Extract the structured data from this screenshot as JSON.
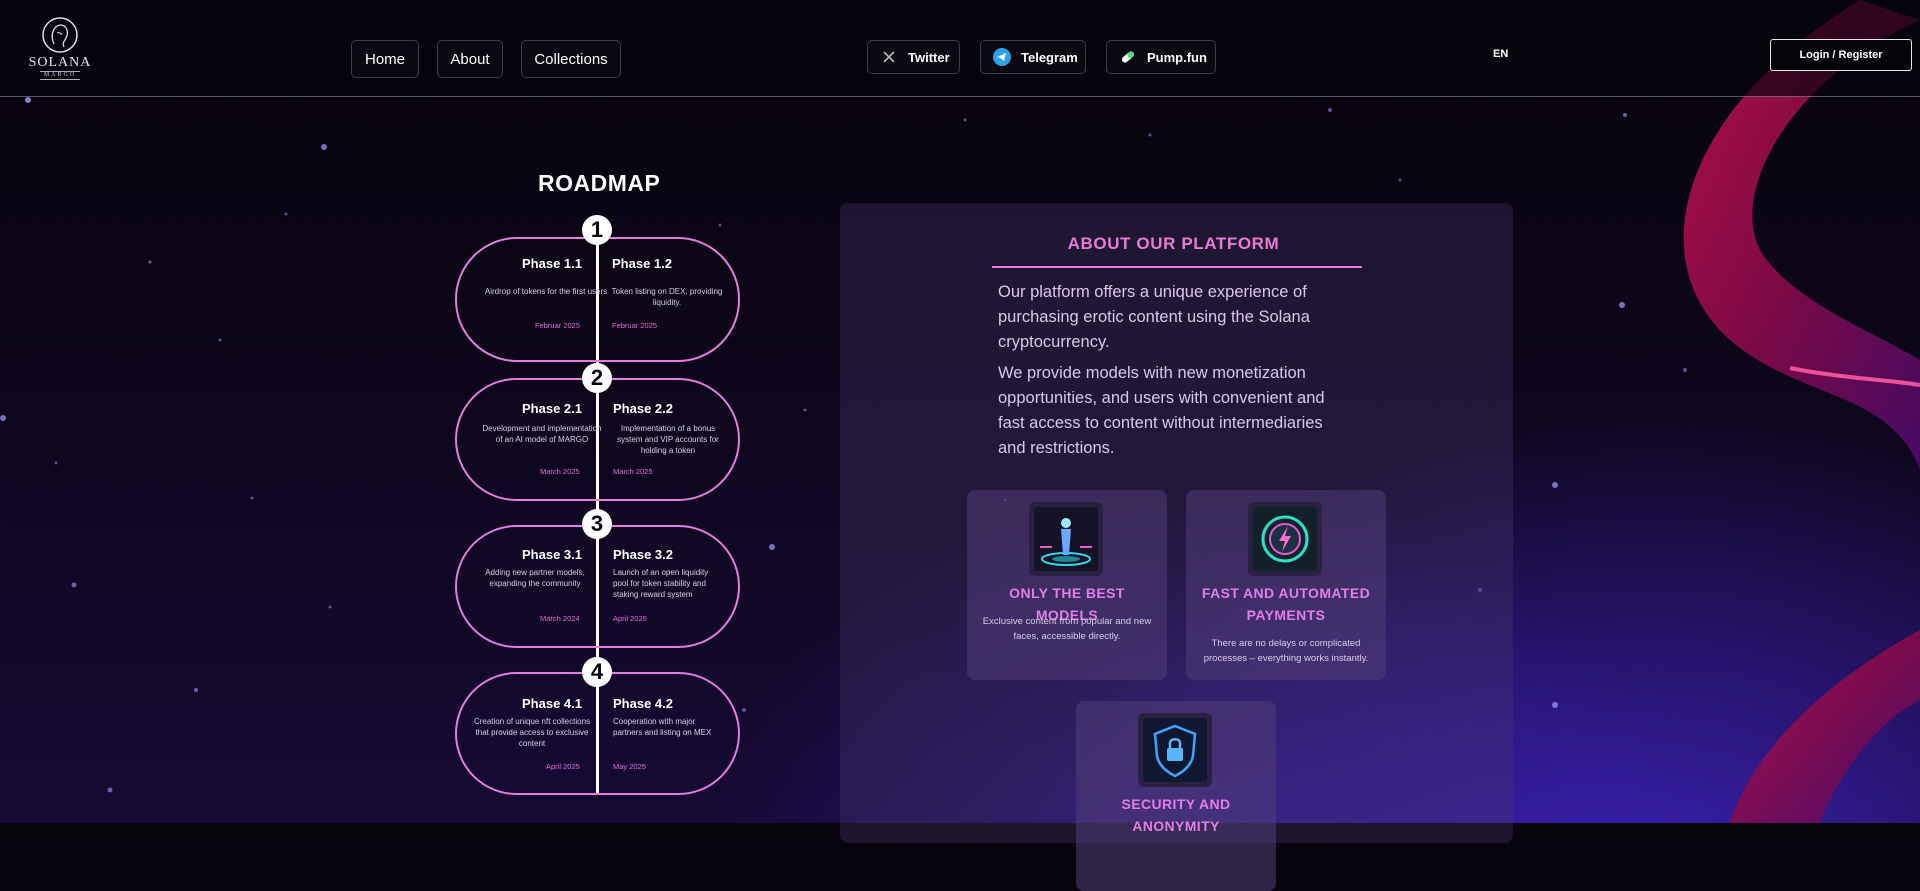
{
  "brand": {
    "name": "SOLANA",
    "sub": "MARGO"
  },
  "nav": [
    {
      "label": "Home"
    },
    {
      "label": "About"
    },
    {
      "label": "Collections"
    }
  ],
  "social": [
    {
      "label": "Twitter",
      "icon": "x-icon"
    },
    {
      "label": "Telegram",
      "icon": "telegram-icon"
    },
    {
      "label": "Pump.fun",
      "icon": "pill-icon"
    }
  ],
  "lang": "EN",
  "login_label": "Login / Register",
  "roadmap": {
    "title": "ROADMAP",
    "stages": [
      {
        "number": "1",
        "left": {
          "title": "Phase 1.1",
          "desc": "Airdrop of tokens for the first users",
          "date": "Februar 2025"
        },
        "right": {
          "title": "Phase 1.2",
          "desc": "Token listing on DEX, providing liquidity.",
          "date": "Februar 2025"
        }
      },
      {
        "number": "2",
        "left": {
          "title": "Phase 2.1",
          "desc": "Development and implementation of an AI model of MARGO",
          "date": "March 2025"
        },
        "right": {
          "title": "Phase 2.2",
          "desc": "Implementation of a bonus system and VIP accounts for holding a token",
          "date": "March 2025"
        }
      },
      {
        "number": "3",
        "left": {
          "title": "Phase 3.1",
          "desc": "Adding new partner models, expanding the community",
          "date": "March 2024"
        },
        "right": {
          "title": "Phase 3.2",
          "desc": "Launch of an open liquidity pool for token stability and staking reward system",
          "date": "April 2025"
        }
      },
      {
        "number": "4",
        "left": {
          "title": "Phase 4.1",
          "desc": "Creation of unique nft collections that provide access to exclusive content",
          "date": "April 2025"
        },
        "right": {
          "title": "Phase 4.2",
          "desc": "Cooperation with major partners and listing on MEX",
          "date": "May 2025"
        }
      }
    ]
  },
  "about": {
    "title": "ABOUT OUR PLATFORM",
    "paragraphs": [
      "Our platform offers a unique experience of purchasing erotic content using the Solana cryptocurrency.",
      "We provide models with new monetization opportunities, and users with convenient and fast access to content without intermediaries and restrictions."
    ],
    "features": [
      {
        "title": "ONLY THE BEST MODELS",
        "desc": "Exclusive content from popular and new faces, accessible directly.",
        "icon": "hologram-model-icon"
      },
      {
        "title": "FAST AND AUTOMATED PAYMENTS",
        "desc": "There are no delays or complicated processes – everything works instantly.",
        "icon": "lightning-payment-icon"
      },
      {
        "title": "SECURITY AND ANONYMITY",
        "desc": "",
        "icon": "shield-lock-icon"
      }
    ]
  },
  "colors": {
    "accent": "#e57ce0",
    "accent_text": "#ea7ad8",
    "panel": "#3a2d58"
  }
}
